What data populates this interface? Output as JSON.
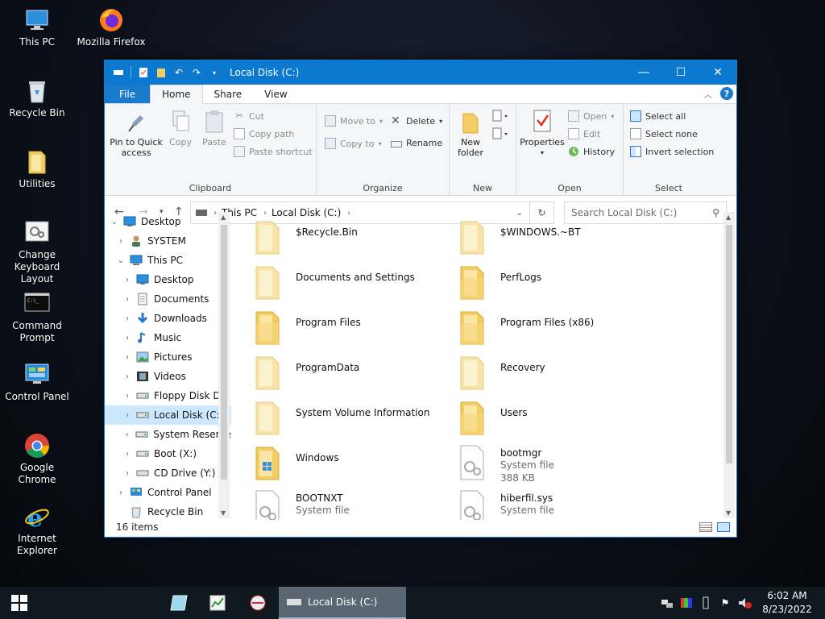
{
  "desktop": {
    "icons": [
      {
        "label": "This PC"
      },
      {
        "label": "Mozilla Firefox"
      },
      {
        "label": "Recycle Bin"
      },
      {
        "label": "Utilities"
      },
      {
        "label": "Change Keyboard Layout"
      },
      {
        "label": "Command Prompt"
      },
      {
        "label": "Control Panel"
      },
      {
        "label": "Google Chrome"
      },
      {
        "label": "Internet Explorer"
      }
    ]
  },
  "window": {
    "title": "Local Disk (C:)",
    "tabs": {
      "file": "File",
      "home": "Home",
      "share": "Share",
      "view": "View"
    },
    "ribbon": {
      "clipboard": {
        "label": "Clipboard",
        "pin": "Pin to Quick access",
        "copy": "Copy",
        "paste": "Paste",
        "cut": "Cut",
        "copy_path": "Copy path",
        "paste_shortcut": "Paste shortcut"
      },
      "organize": {
        "label": "Organize",
        "move_to": "Move to",
        "copy_to": "Copy to",
        "delete": "Delete",
        "rename": "Rename"
      },
      "new": {
        "label": "New",
        "new_folder": "New folder"
      },
      "open": {
        "label": "Open",
        "properties": "Properties",
        "open": "Open",
        "edit": "Edit",
        "history": "History"
      },
      "select": {
        "label": "Select",
        "select_all": "Select all",
        "select_none": "Select none",
        "invert": "Invert selection"
      }
    },
    "address": {
      "crumbs": [
        "This PC",
        "Local Disk (C:)"
      ]
    },
    "search": {
      "placeholder": "Search Local Disk (C:)"
    },
    "tree": [
      {
        "label": "Desktop"
      },
      {
        "label": "SYSTEM"
      },
      {
        "label": "This PC"
      },
      {
        "label": "Desktop"
      },
      {
        "label": "Documents"
      },
      {
        "label": "Downloads"
      },
      {
        "label": "Music"
      },
      {
        "label": "Pictures"
      },
      {
        "label": "Videos"
      },
      {
        "label": "Floppy Disk Dri"
      },
      {
        "label": "Local Disk (C:)"
      },
      {
        "label": "System Reserve"
      },
      {
        "label": "Boot (X:)"
      },
      {
        "label": "CD Drive (Y:) H"
      },
      {
        "label": "Control Panel"
      },
      {
        "label": "Recycle Bin"
      }
    ],
    "files": [
      {
        "name": "$Recycle.Bin",
        "type": "",
        "size": ""
      },
      {
        "name": "$WINDOWS.~BT",
        "type": "",
        "size": ""
      },
      {
        "name": "Documents and Settings",
        "type": "",
        "size": ""
      },
      {
        "name": "PerfLogs",
        "type": "",
        "size": ""
      },
      {
        "name": "Program Files",
        "type": "",
        "size": ""
      },
      {
        "name": "Program Files (x86)",
        "type": "",
        "size": ""
      },
      {
        "name": "ProgramData",
        "type": "",
        "size": ""
      },
      {
        "name": "Recovery",
        "type": "",
        "size": ""
      },
      {
        "name": "System Volume Information",
        "type": "",
        "size": ""
      },
      {
        "name": "Users",
        "type": "",
        "size": ""
      },
      {
        "name": "Windows",
        "type": "",
        "size": ""
      },
      {
        "name": "bootmgr",
        "type": "System file",
        "size": "388 KB"
      },
      {
        "name": "BOOTNXT",
        "type": "System file",
        "size": ""
      },
      {
        "name": "hiberfil.sys",
        "type": "System file",
        "size": ""
      }
    ],
    "status": "16 items"
  },
  "taskbar": {
    "active_label": "Local Disk (C:)",
    "time": "6:02 AM",
    "date": "8/23/2022"
  },
  "colors": {
    "accent": "#0c79d0",
    "folder": "#f2cd63",
    "selection": "#cce8ff"
  }
}
